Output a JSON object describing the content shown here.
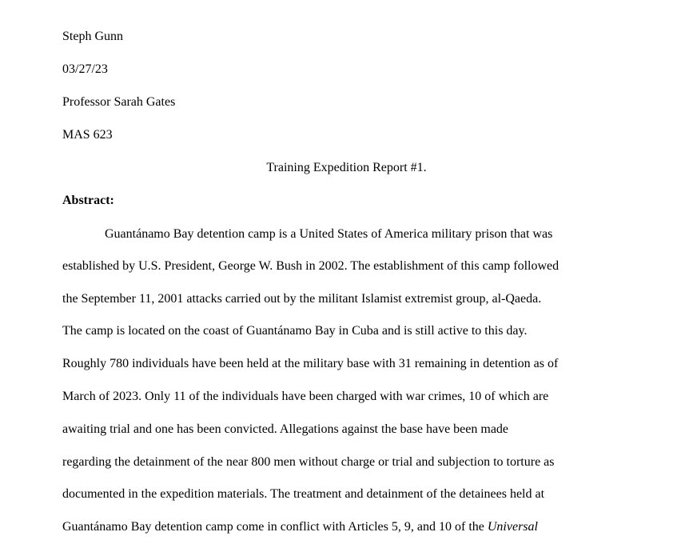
{
  "header": {
    "author": "Steph Gunn",
    "date": "03/27/23",
    "professor": "Professor Sarah Gates",
    "course": "MAS 623"
  },
  "title": "Training Expedition Report #1.",
  "section_heading": "Abstract:",
  "body_lines": [
    "Guantánamo Bay detention camp is a United States of America military prison that was",
    "established by U.S. President, George W. Bush in 2002. The establishment of this camp followed",
    "the September 11, 2001 attacks carried out by the militant Islamist extremist group, al-Qaeda.",
    "The camp is located on the coast of Guantánamo Bay in Cuba and is still active to this day.",
    "Roughly 780 individuals have been held at the military base with 31 remaining in detention as of",
    "March of 2023. Only 11 of the individuals have been charged with war crimes, 10 of which are",
    "awaiting trial and one has been convicted. Allegations against the base have been made",
    "regarding the detainment of the near 800 men without charge or trial and subjection to torture as",
    "documented in the expedition materials. The treatment and detainment of the detainees held at"
  ],
  "last_line": {
    "text": "Guantánamo Bay detention camp come in conflict with Articles 5, 9, and 10 of the ",
    "italic": "Universal"
  }
}
